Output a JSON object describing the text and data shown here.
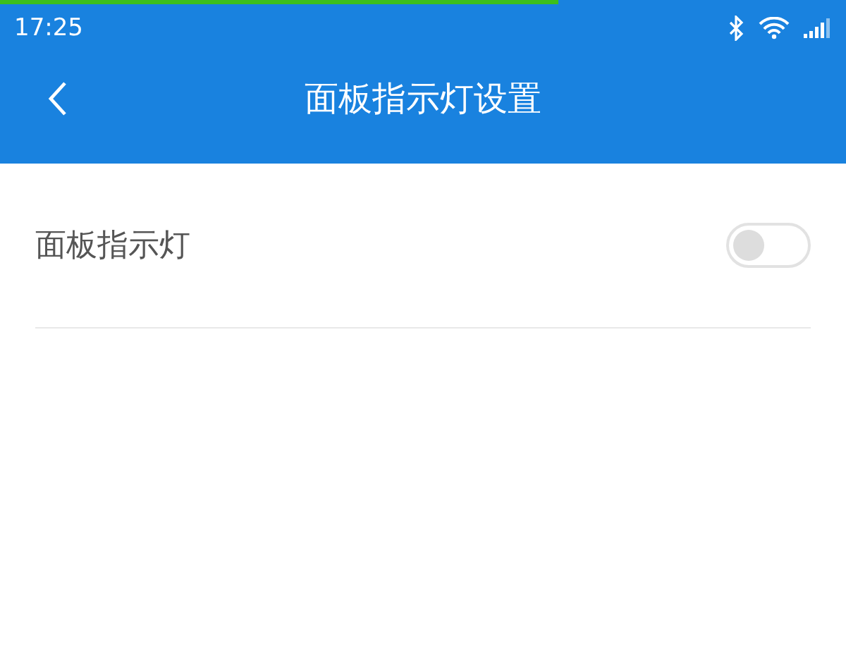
{
  "status_bar": {
    "time": "17:25"
  },
  "loading_bar": {
    "level": 0.66
  },
  "header": {
    "title": "面板指示灯设置"
  },
  "settings": [
    {
      "kind": "toggle",
      "label": "面板指示灯",
      "on": false
    }
  ]
}
